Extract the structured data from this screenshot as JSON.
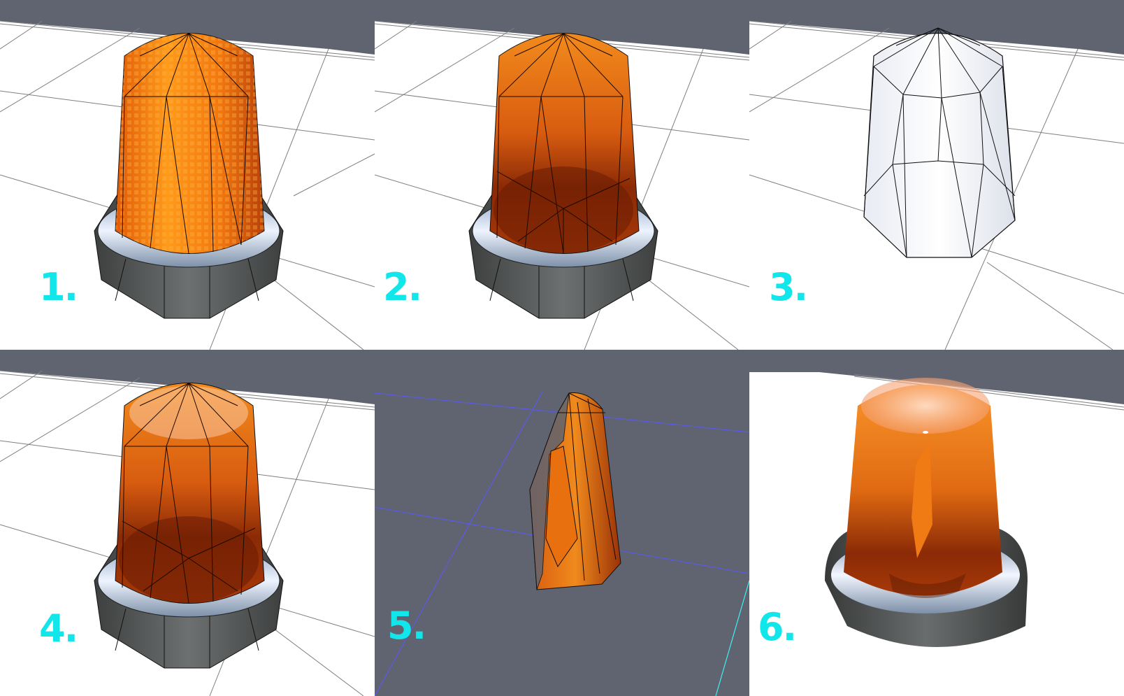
{
  "colors": {
    "label": "#11e6ea",
    "viewport_bg": "#5f6470",
    "ground": "#ffffff",
    "orange_light": "#ff9a1a",
    "orange_mid": "#e8620c",
    "orange_dark": "#7a2206",
    "base_gray": "#5a5c5c",
    "ring_silver": "#c7d7ea",
    "gizmo_blue": "#5a5ae8",
    "gizmo_cyan": "#3ff0f0"
  },
  "panels": [
    {
      "label": "1.",
      "variant": "solid-wire"
    },
    {
      "label": "2.",
      "variant": "transparent-wire"
    },
    {
      "label": "3.",
      "variant": "wire-only"
    },
    {
      "label": "4.",
      "variant": "transparent-wire-highlight"
    },
    {
      "label": "5.",
      "variant": "cutaway"
    },
    {
      "label": "6.",
      "variant": "final-render"
    }
  ]
}
